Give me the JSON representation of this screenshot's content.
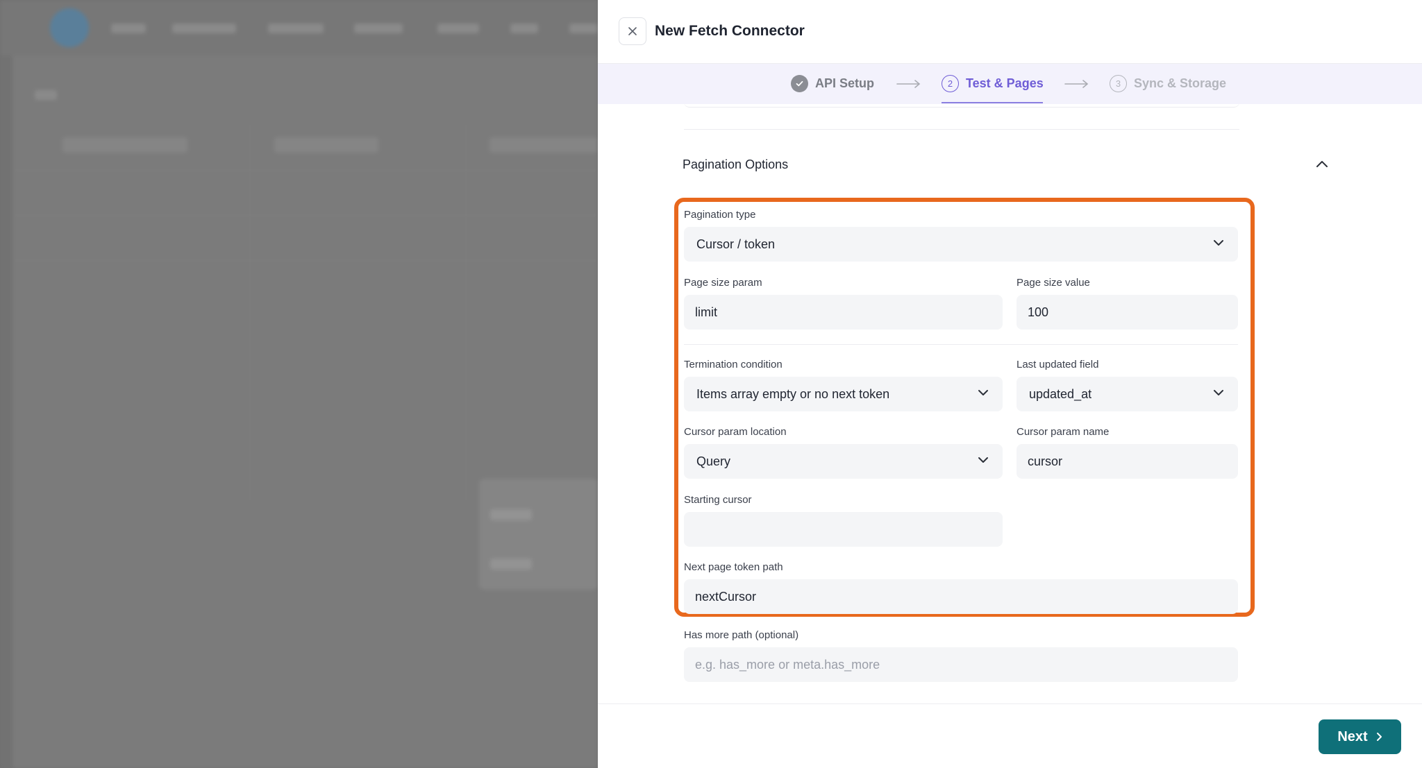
{
  "drawer": {
    "title": "New Fetch Connector",
    "close_icon": "close-icon"
  },
  "stepper": {
    "steps": [
      {
        "number": "",
        "label": "API Setup",
        "state": "done"
      },
      {
        "number": "2",
        "label": "Test & Pages",
        "state": "active"
      },
      {
        "number": "3",
        "label": "Sync & Storage",
        "state": "todo"
      }
    ]
  },
  "pagination": {
    "section_title": "Pagination Options",
    "type": {
      "label": "Pagination type",
      "value": "Cursor / token"
    },
    "page_size_param": {
      "label": "Page size param",
      "value": "limit"
    },
    "page_size_value": {
      "label": "Page size value",
      "value": "100"
    },
    "termination": {
      "label": "Termination condition",
      "value": "Items array empty or no next token"
    },
    "last_updated": {
      "label": "Last updated field",
      "value": "updated_at"
    },
    "cursor_location": {
      "label": "Cursor param location",
      "value": "Query"
    },
    "cursor_name": {
      "label": "Cursor param name",
      "value": "cursor"
    },
    "starting_cursor": {
      "label": "Starting cursor",
      "value": ""
    },
    "next_token_path": {
      "label": "Next page token path",
      "value": "nextCursor"
    },
    "has_more_path": {
      "label": "Has more path (optional)",
      "placeholder": "e.g. has_more or meta.has_more"
    }
  },
  "footer": {
    "next_label": "Next"
  },
  "colors": {
    "accent": "#6f5dd6",
    "highlight": "#e8681d",
    "primary_button": "#0f7079"
  }
}
